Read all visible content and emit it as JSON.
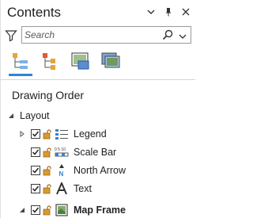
{
  "pane": {
    "title": "Contents",
    "tools": {
      "options_icon": "dropdown-arrow",
      "pin_icon": "pin",
      "close_icon": "close"
    }
  },
  "search": {
    "placeholder": "Search",
    "value": ""
  },
  "views": [
    {
      "name": "list-by-drawing-order",
      "active": true
    },
    {
      "name": "list-by-source",
      "active": false
    },
    {
      "name": "list-by-selection",
      "active": false
    },
    {
      "name": "list-by-perspective",
      "active": false
    }
  ],
  "section": {
    "heading": "Drawing Order"
  },
  "tree": {
    "root": {
      "label": "Layout",
      "expanded": true
    },
    "items": [
      {
        "label": "Legend",
        "checked": true,
        "icon": "legend",
        "expandable": true,
        "expanded": false,
        "bold": false
      },
      {
        "label": "Scale Bar",
        "checked": true,
        "icon": "scale-bar",
        "expandable": false,
        "bold": false
      },
      {
        "label": "North Arrow",
        "checked": true,
        "icon": "north-arrow",
        "expandable": false,
        "bold": false
      },
      {
        "label": "Text",
        "checked": true,
        "icon": "text",
        "expandable": false,
        "bold": false
      },
      {
        "label": "Map Frame",
        "checked": true,
        "icon": "map-frame",
        "expandable": true,
        "expanded": true,
        "bold": true
      }
    ]
  },
  "colors": {
    "accent": "#2f84d6",
    "lock": "#d99a2b",
    "text": "#222222"
  }
}
